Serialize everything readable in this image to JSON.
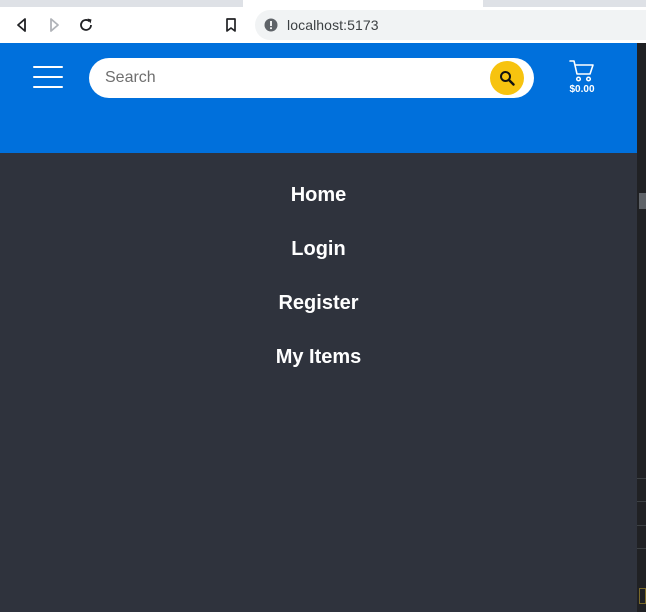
{
  "browser": {
    "url": "localhost:5173"
  },
  "header": {
    "search": {
      "placeholder": "Search",
      "value": ""
    },
    "cart": {
      "total": "$0.00"
    },
    "colors": {
      "header_bg": "#0070dc",
      "search_button": "#f7c30f"
    }
  },
  "menu": {
    "items": [
      {
        "label": "Home"
      },
      {
        "label": "Login"
      },
      {
        "label": "Register"
      },
      {
        "label": "My Items"
      }
    ],
    "colors": {
      "background": "#2f333d",
      "text": "#ffffff"
    }
  },
  "icons": {
    "back": "back-arrow-icon",
    "forward": "forward-arrow-icon",
    "reload": "reload-icon",
    "bookmark": "bookmark-icon",
    "site_info": "info-icon",
    "menu": "hamburger-icon",
    "search": "search-icon",
    "cart": "cart-icon"
  }
}
